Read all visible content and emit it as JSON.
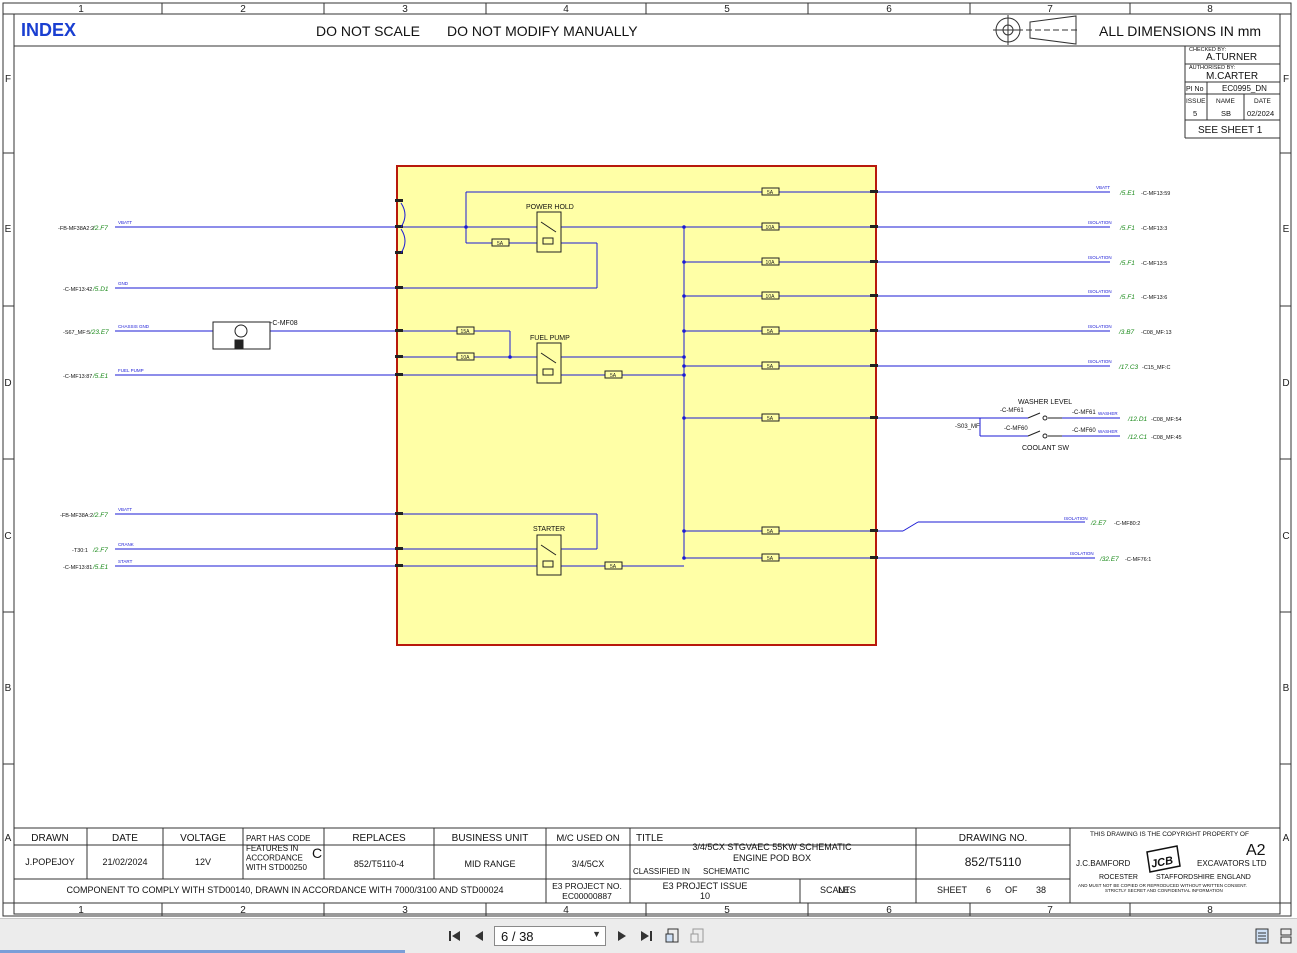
{
  "header": {
    "index_label": "INDEX",
    "do_not_scale": "DO NOT SCALE",
    "do_not_modify": "DO NOT MODIFY MANUALLY",
    "dimensions": "ALL DIMENSIONS IN mm"
  },
  "grid": {
    "columns": [
      "1",
      "2",
      "3",
      "4",
      "5",
      "6",
      "7",
      "8"
    ],
    "rows": [
      "F",
      "E",
      "D",
      "C",
      "B",
      "A"
    ]
  },
  "revision_box": {
    "checked_by_label": "CHECKED BY:",
    "checked_by": "A.TURNER",
    "authorised_by_label": "AUTHORISED BY:",
    "authorised_by": "M.CARTER",
    "pi_no_label": "PI No",
    "pi_no": "EC0995_DN",
    "issue_label": "ISSUE",
    "name_label": "NAME",
    "date_label": "DATE",
    "issue": "5",
    "name": "SB",
    "date": "02/2024",
    "see_sheet": "SEE SHEET 1"
  },
  "schematic": {
    "power_hold": "POWER HOLD",
    "fuel_pump": "FUEL PUMP",
    "starter": "STARTER",
    "washer_level": "WASHER LEVEL",
    "coolant_sw": "COOLANT SW",
    "motor_ref": "-C-MF08",
    "washer_ref": "-C-MF61",
    "coolant_ref": "-C-MF60",
    "washer_ref2": "-C-MF61",
    "coolant_ref2": "-C-MF60",
    "sensor_ref": "-S03_MF",
    "fuses": [
      "5A",
      "10A",
      "10A",
      "10A",
      "5A",
      "5A",
      "5A",
      "5A",
      "5A",
      "5A",
      "15A",
      "10A",
      "5A",
      "5A"
    ],
    "left_wires": [
      {
        "ref": "-FB-MF38A2:2",
        "link": "/2.F7",
        "signal": "VBATT"
      },
      {
        "ref": "-C-MF13:42",
        "link": "/5.D1",
        "signal": "GND"
      },
      {
        "ref": "-S67_MF:5",
        "link": "/23.E7",
        "signal": "CHASSIS GND"
      },
      {
        "ref": "-C-MF13:87",
        "link": "/5.E1",
        "signal": "FUEL PUMP"
      },
      {
        "ref": "-FB-MF38A:2",
        "link": "/2.F7",
        "signal": "VBATT"
      },
      {
        "ref": "-T30:1",
        "link": "/2.F7",
        "signal": "CRANK"
      },
      {
        "ref": "-C-MF13:81",
        "link": "/5.E1",
        "signal": "START"
      }
    ],
    "right_wires": [
      {
        "ref": "-C-MF13:59",
        "link": "/5.E1",
        "signal": "VBATT"
      },
      {
        "ref": "-C-MF13:3",
        "link": "/5.F1",
        "signal": "ISOLATION"
      },
      {
        "ref": "-C-MF13:5",
        "link": "/5.F1",
        "signal": "ISOLATION"
      },
      {
        "ref": "-C-MF13:6",
        "link": "/5.F1",
        "signal": "ISOLATION"
      },
      {
        "ref": "-C08_MF:13",
        "link": "/3.B7",
        "signal": "ISOLATION"
      },
      {
        "ref": "-C15_MF:C",
        "link": "/17.C3",
        "signal": "ISOLATION"
      },
      {
        "ref": "-C08_MF:54",
        "link": "/12.D1",
        "signal": "WASHER"
      },
      {
        "ref": "-C08_MF:45",
        "link": "/12.C1",
        "signal": "WASHER"
      },
      {
        "ref": "-C-MF80:2",
        "link": "/2.E7",
        "signal": "ISOLATION"
      },
      {
        "ref": "-C-MF76:1",
        "link": "/32.E7",
        "signal": "ISOLATION"
      }
    ]
  },
  "title_block": {
    "drawn_label": "DRAWN",
    "drawn": "J.POPEJOY",
    "date_label": "DATE",
    "date": "21/02/2024",
    "voltage_label": "VOLTAGE",
    "voltage": "12V",
    "part_code_label": "PART HAS CODE",
    "features_text": "FEATURES IN ACCORDANCE WITH STD00250",
    "code_letter": "C",
    "replaces_label": "REPLACES",
    "replaces": "852/T5110-4",
    "business_unit_label": "BUSINESS UNIT",
    "business_unit": "MID RANGE",
    "mc_used_label": "M/C USED ON",
    "mc_used": "3/4/5CX",
    "title_label": "TITLE",
    "title_line1": "3/4/5CX STGVAEC 55KW SCHEMATIC",
    "title_line2": "ENGINE POD BOX",
    "classified_label": "CLASSIFIED IN",
    "classified": "SCHEMATIC",
    "drawing_no_label": "DRAWING NO.",
    "drawing_no": "852/T5110",
    "copyright": "THIS DRAWING IS THE COPYRIGHT PROPERTY OF",
    "size": "A2",
    "company1": "J.C.BAMFORD",
    "company2": "EXCAVATORS LTD",
    "logo_text": "JCB",
    "town": "ROCESTER",
    "county": "STAFFORDSHIRE",
    "country": "ENGLAND",
    "secret1": "AND MUST NOT BE COPIED OR REPRODUCED WITHOUT WRITTEN CONSENT.",
    "secret2": "STRICTLY SECRET AND CONFIDENTIAL INFORMATION",
    "comply": "COMPONENT TO COMPLY WITH STD00140, DRAWN IN ACCORDANCE WITH 7000/3100 AND STD00024",
    "e3_project_label": "E3 PROJECT NO.",
    "e3_project": "EC00000887",
    "e3_issue_label": "E3 PROJECT ISSUE",
    "e3_issue": "10",
    "scale_label": "SCALE:",
    "scale": "NTS",
    "sheet_label": "SHEET",
    "sheet": "6",
    "of_label": "OF",
    "total_sheets": "38"
  },
  "viewer": {
    "page_field": "6 / 38"
  }
}
